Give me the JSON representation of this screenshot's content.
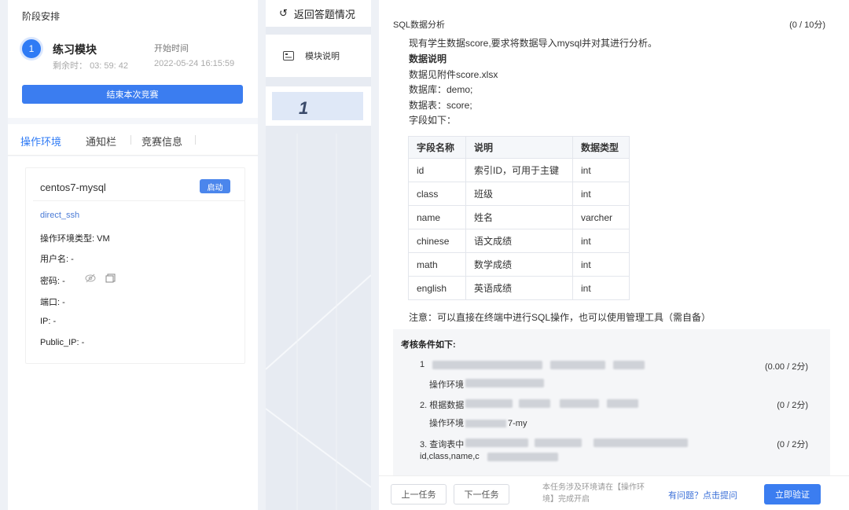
{
  "stage": {
    "title": "阶段安排",
    "step_number": "1",
    "module_name": "练习模块",
    "start_label": "开始时间",
    "remaining_label": "剩余时：",
    "remaining_time": "03: 59: 42",
    "start_time": "2022-05-24 16:15:59",
    "end_button": "结束本次竞赛"
  },
  "tabs": [
    "操作环境",
    "通知栏",
    "竞赛信息"
  ],
  "environment": {
    "name": "centos7-mysql",
    "start_button": "启动",
    "link": "direct_ssh",
    "type_label": "操作环境类型:",
    "type_value": "VM",
    "username_label": "用户名:",
    "username_value": "-",
    "password_label": "密码:",
    "password_value": "-",
    "port_label": "端口:",
    "port_value": "-",
    "ip_label": "IP:",
    "ip_value": "-",
    "public_ip_label": "Public_IP:",
    "public_ip_value": "-"
  },
  "middle": {
    "return_label": "返回答题情况",
    "module_label": "模块说明",
    "task_number": "1"
  },
  "task": {
    "title": "SQL数据分析",
    "score": "(0 / 10分)",
    "intro": "现有学生数据score,要求将数据导入mysql并对其进行分析。",
    "data_heading": "数据说明",
    "attachment": "数据见附件score.xlsx",
    "database": "数据库：demo;",
    "table": "数据表：score;",
    "fields_line": "字段如下：",
    "columns": [
      "字段名称",
      "说明",
      "数据类型"
    ],
    "rows": [
      [
        "id",
        "索引ID，可用于主键",
        "int"
      ],
      [
        "class",
        "班级",
        "int"
      ],
      [
        "name",
        "姓名",
        "varcher"
      ],
      [
        "chinese",
        "语文成绩",
        "int"
      ],
      [
        "math",
        "数学成绩",
        "int"
      ],
      [
        "english",
        "英语成绩",
        "int"
      ]
    ],
    "note": "注意：可以直接在终端中进行SQL操作，也可以使用管理工具（需自备）"
  },
  "conditions": {
    "title": "考核条件如下:",
    "items": [
      {
        "text": "1",
        "sub": "操作环境",
        "score": "(0.00 / 2分)"
      },
      {
        "text": "2. 根据数据",
        "sub": "操作环境",
        "sub_tail": "7-my",
        "score": "(0 / 2分)"
      },
      {
        "text": "3. 查询表中",
        "sub": "id,class,name,c",
        "score": "(0 / 2分)"
      }
    ]
  },
  "footer": {
    "prev": "上一任务",
    "next": "下一任务",
    "hint": "本任务涉及环境请在【操作环境】完成开启",
    "ask": "有问题？点击提问",
    "verify": "立即验证"
  }
}
